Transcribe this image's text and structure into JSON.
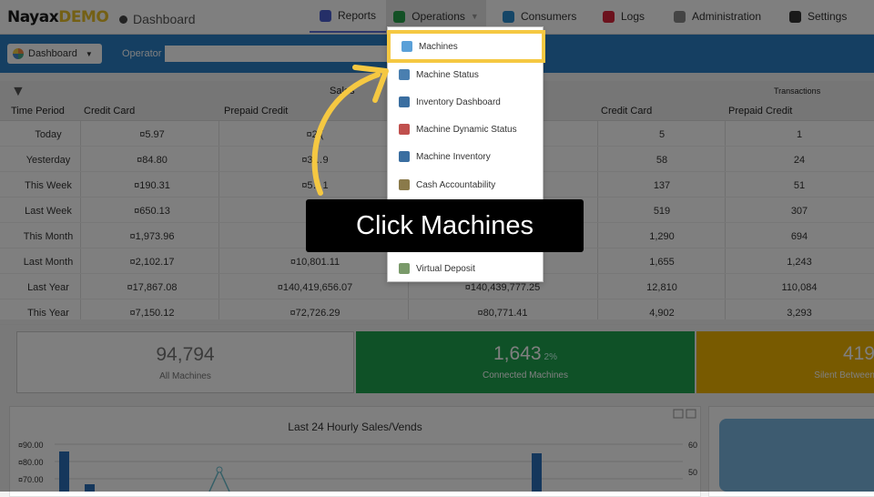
{
  "app": {
    "logo_main": "Nayax",
    "logo_demo": "DEMO",
    "breadcrumb": "Dashboard"
  },
  "nav": [
    {
      "label": "Reports",
      "icon": "chart-icon",
      "color": "#4a5fd0"
    },
    {
      "label": "Operations",
      "icon": "operations-icon",
      "color": "#27a04a"
    },
    {
      "label": "Consumers",
      "icon": "consumers-icon",
      "color": "#2b8ccf"
    },
    {
      "label": "Logs",
      "icon": "logs-icon",
      "color": "#d9243a"
    },
    {
      "label": "Administration",
      "icon": "admin-icon",
      "color": "#888888"
    },
    {
      "label": "Settings",
      "icon": "settings-icon",
      "color": "#333333"
    }
  ],
  "toolbar": {
    "dashboard_label": "Dashboard",
    "operator_label": "Operator",
    "operator_value": ""
  },
  "table": {
    "group_sales": "Sales",
    "group_transactions": "Transactions",
    "headers": [
      "Time Period",
      "Credit Card",
      "Prepaid Credit",
      "",
      "Credit Card",
      "Prepaid Credit"
    ],
    "rows": [
      {
        "period": "Today",
        "cc": "¤5.97",
        "pc": "¤2.(",
        "x": "",
        "tcc": "5",
        "tpc": "1"
      },
      {
        "period": "Yesterday",
        "cc": "¤84.80",
        "pc": "¤3…9",
        "x": "",
        "tcc": "58",
        "tpc": "24"
      },
      {
        "period": "This Week",
        "cc": "¤190.31",
        "pc": "¤5…1",
        "x": "",
        "tcc": "137",
        "tpc": "51"
      },
      {
        "period": "Last Week",
        "cc": "¤650.13",
        "pc": "¤2",
        "x": "",
        "tcc": "519",
        "tpc": "307"
      },
      {
        "period": "This Month",
        "cc": "¤1,973.96",
        "pc": "¤9",
        "x": "",
        "tcc": "1,290",
        "tpc": "694"
      },
      {
        "period": "Last Month",
        "cc": "¤2,102.17",
        "pc": "¤10,801.11",
        "x": "",
        "tcc": "1,655",
        "tpc": "1,243"
      },
      {
        "period": "Last Year",
        "cc": "¤17,867.08",
        "pc": "¤140,419,656.07",
        "x": "¤140,439,777.25",
        "tcc": "12,810",
        "tpc": "110,084"
      },
      {
        "period": "This Year",
        "cc": "¤7,150.12",
        "pc": "¤72,726.29",
        "x": "¤80,771.41",
        "tcc": "4,902",
        "tpc": "3,293"
      }
    ]
  },
  "cards": {
    "all_value": "94,794",
    "all_label": "All Machines",
    "conn_value": "1,643",
    "conn_pct": "2%",
    "conn_label": "Connected Machines",
    "silent_value": "419",
    "silent_label": "Silent Between"
  },
  "chart_data": {
    "type": "bar",
    "title": "Last 24 Hourly Sales/Vends",
    "yticks_left": [
      "¤90.00",
      "¤80.00",
      "¤70.00"
    ],
    "yticks_right": [
      "60",
      "50"
    ],
    "colors": {
      "bar": "#2a6fb8",
      "line": "#6bbfcf"
    }
  },
  "menu": {
    "items": [
      {
        "label": "Machines",
        "icon": "machines-icon"
      },
      {
        "label": "Machine Status",
        "icon": "machine-status-icon"
      },
      {
        "label": "Inventory Dashboard",
        "icon": "inventory-dashboard-icon"
      },
      {
        "label": "Machine Dynamic Status",
        "icon": "dynamic-status-icon"
      },
      {
        "label": "Machine Inventory",
        "icon": "machine-inventory-icon"
      },
      {
        "label": "Cash Accountability",
        "icon": "cash-icon"
      },
      {
        "label": "Virtual Deposit",
        "icon": "virtual-deposit-icon"
      }
    ]
  },
  "callout": {
    "text": "Click Machines"
  },
  "accent": {
    "highlight": "#f5c842",
    "toolbar": "#2a7ec4"
  }
}
